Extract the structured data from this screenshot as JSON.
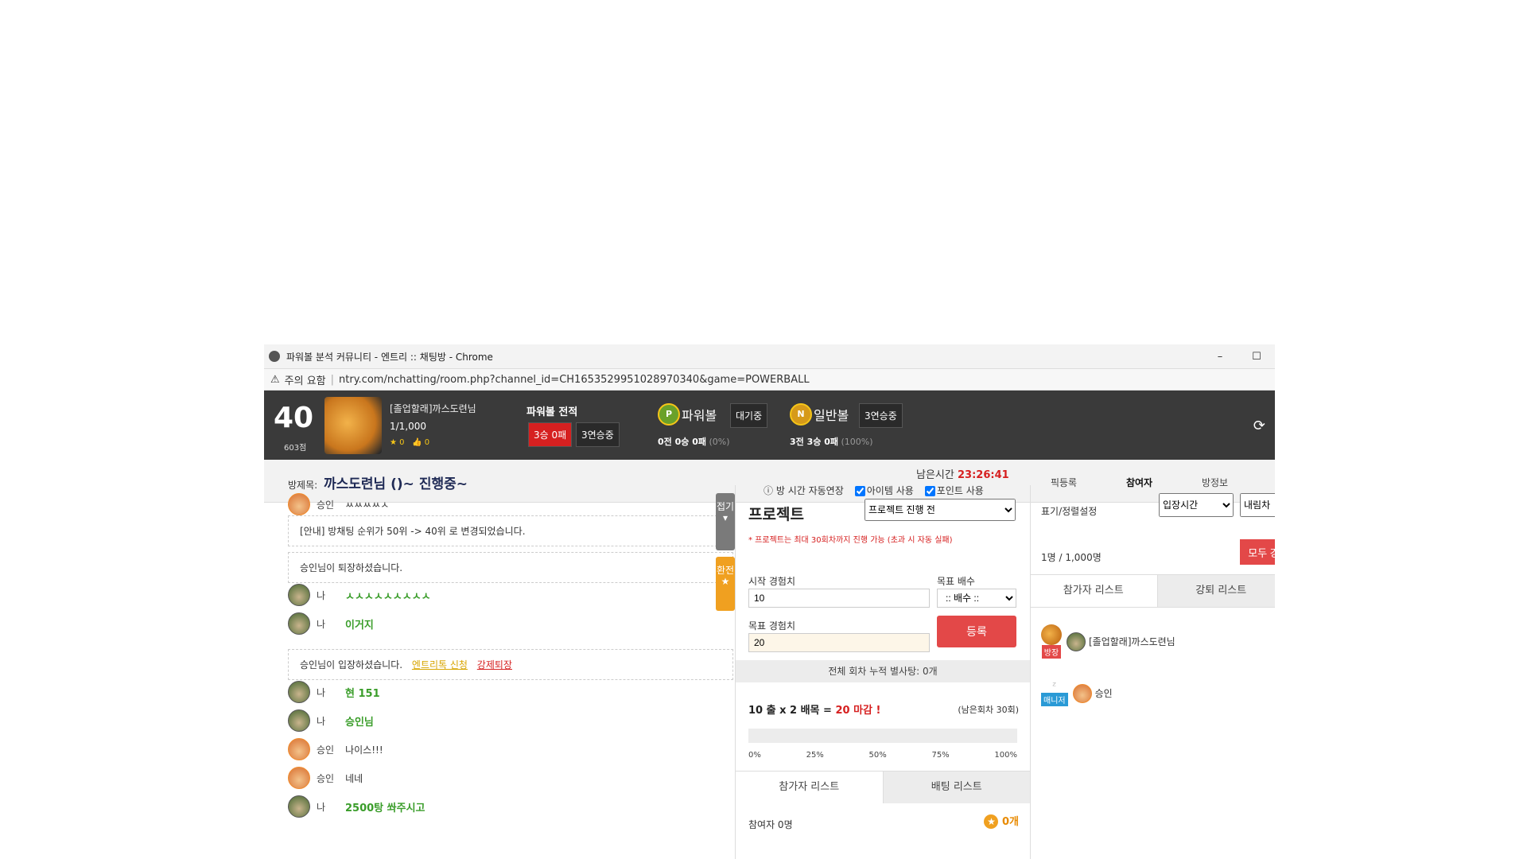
{
  "window": {
    "title": "파워볼 분석 커뮤니티 - 엔트리 :: 채팅방 - Chrome",
    "minimize": "–",
    "maximize": "☐"
  },
  "urlbar": {
    "warning": "주의 요함",
    "url": "ntry.com/nchatting/room.php?channel_id=CH1653529951028970340&game=POWERBALL"
  },
  "profile": {
    "level": "40",
    "points": "603점",
    "name": "[졸업할래]까스도련님",
    "rank": "1/1,000",
    "stars": "★ 0",
    "likes": "👍 0"
  },
  "record": {
    "title": "파워볼 전적",
    "wins": "3승 0패",
    "streak": "3연승중"
  },
  "powerball": {
    "icon": "P",
    "label": "파워볼",
    "status": "대기중",
    "summary": "0전 0승 0패",
    "pct": "(0%)"
  },
  "normalball": {
    "icon": "N",
    "label": "일반볼",
    "status": "3연승중",
    "summary": "3전 3승 0패",
    "pct": "(100%)"
  },
  "room": {
    "label": "방제목:",
    "title": "까스도련님 ()~ 진행중~",
    "remain_label": "남은시간",
    "remain": "23:26:41",
    "auto_extend": "방 시간 자동연장",
    "item_use": "아이템 사용",
    "point_use": "포인트 사용"
  },
  "header_tabs": [
    "픽등록",
    "참여자",
    "방정보",
    "("
  ],
  "chat": {
    "lines": [
      {
        "type": "msg",
        "avatar": "new",
        "who": "승인",
        "text": "ㅆㅆㅆㅆㅅ",
        "style": "n"
      },
      {
        "type": "notice",
        "text": "[안내] 방채팅 순위가 50위 -> 40위 로 변경되었습니다."
      },
      {
        "type": "notice",
        "text": "승인님이 퇴장하셨습니다."
      },
      {
        "type": "msg",
        "avatar": "me",
        "who": "나",
        "text": "ㅅㅅㅅㅅㅅㅅㅅㅅㅅ",
        "style": "g"
      },
      {
        "type": "msg",
        "avatar": "me",
        "who": "나",
        "text": "이거지",
        "style": "g"
      },
      {
        "type": "notice2",
        "text": "승인님이 입장하셨습니다.",
        "link1": "엔트리톡 신청",
        "link2": "강제퇴장"
      },
      {
        "type": "msg",
        "avatar": "me",
        "who": "나",
        "text": "현 151",
        "style": "g"
      },
      {
        "type": "msg",
        "avatar": "me",
        "who": "나",
        "text": "승인님",
        "style": "g"
      },
      {
        "type": "msg",
        "avatar": "new",
        "who": "승인",
        "text": "나이스!!!",
        "style": "n"
      },
      {
        "type": "msg",
        "avatar": "new",
        "who": "승인",
        "text": "네네",
        "style": "n"
      },
      {
        "type": "msg",
        "avatar": "me",
        "who": "나",
        "text": "2500탕 쏴주시고",
        "style": "g"
      }
    ],
    "fold_btn": "접기",
    "exchange_btn": "환전"
  },
  "project": {
    "title": "프로젝트",
    "select": "프로젝트 진행 전",
    "warning": "* 프로젝트는 최대 30회차까지 진행 가능 (초과 시 자동 실패)",
    "start_label": "시작 경험치",
    "start_value": "10",
    "multi_label": "목표 배수",
    "multi_value": ":: 배수 ::",
    "goal_label": "목표 경험치",
    "goal_value": "20",
    "register": "등록",
    "cumulative": "전체 회차 누적 별사탕: 0개",
    "goal_text": "10 출 x 2 배목 =",
    "goal_deadline": "20 마감 !",
    "remaining": "(남은회차 30회)",
    "progress": 0,
    "ticks": [
      "0%",
      "25%",
      "50%",
      "75%",
      "100%"
    ],
    "tab_participants": "참가자 리스트",
    "tab_bets": "배팅 리스트",
    "participants": "참여자 0명",
    "items": "0개"
  },
  "sidebar_right": {
    "sort_label": "표기/정렬설정",
    "sort1": "입장시간",
    "sort2": "내림차",
    "user_count": "1명 / 1,000명",
    "kick_all": "모두 강",
    "tab_participants": "참가자 리스트",
    "tab_kicked": "강퇴 리스트",
    "users": [
      {
        "name": "[졸업할래]까스도련님",
        "tag": "방장",
        "tag_color": "#e34848"
      },
      {
        "name": "승인",
        "tag": "매니저",
        "tag_color": "#2a9ad6"
      }
    ]
  },
  "colors": {
    "topbar": "#3a3a3a",
    "accent_red": "#e34848",
    "chat_green": "#3a9d2a",
    "remain_red": "#d62020",
    "powerball_coin": "#6aa12a",
    "normalball_coin": "#d69a1a"
  }
}
